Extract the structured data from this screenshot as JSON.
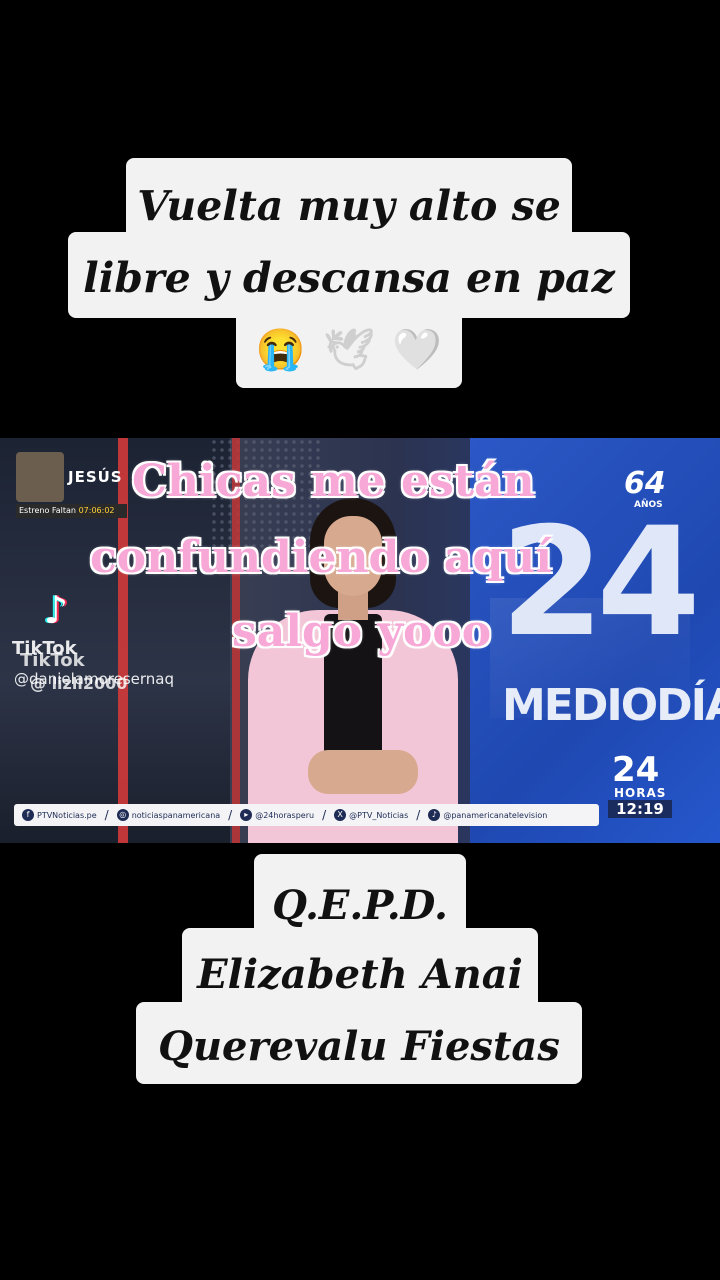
{
  "top_caption": {
    "line1": "Vuelta muy alto se",
    "line2": "libre y descansa en paz",
    "emojis": [
      "😭",
      "🕊",
      "🤍"
    ]
  },
  "video": {
    "channel_name": "JESÚS",
    "estreno_label": "Estreno Faltan",
    "estreno_time": "07:06:02",
    "tiktok_word": "TikTok",
    "tiktok_user_1": "@danielamoresernaq",
    "tiktok_user_2": "@ lizll2000",
    "overlay_line1": "Chicas me están",
    "overlay_line2": "confundiendo aquí",
    "overlay_line3": "salgo yooo",
    "logo_64": "64",
    "logo_anios": "AÑOS",
    "logo_24": "24",
    "mediodia": "MEDIODÍA",
    "hour_24": "24",
    "horas": "HORAS",
    "clock": "12:19",
    "social": [
      "PTVNoticias.pe",
      "noticiaspanamericana",
      "@24horasperu",
      "@PTV_Noticias",
      "@panamericanatelevision"
    ]
  },
  "bottom_caption": {
    "line1": "Q.E.P.D.",
    "line2": "Elizabeth Anai",
    "line3": "Querevalu Fiestas"
  }
}
